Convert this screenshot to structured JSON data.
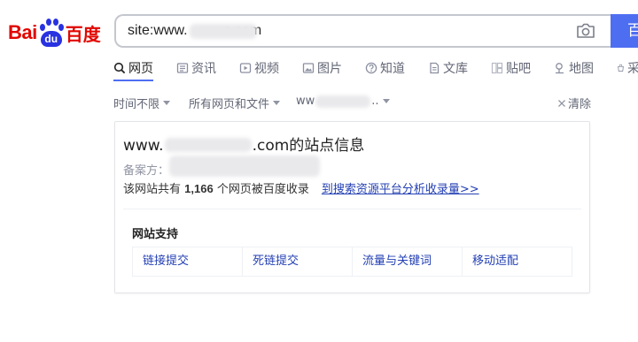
{
  "logo": {
    "bai": "Bai",
    "du": "du",
    "cn": "百度"
  },
  "search": {
    "query": "site:www.         o.com",
    "button_label": "百"
  },
  "tabs": [
    {
      "label": "网页",
      "icon": "search-icon",
      "active": true
    },
    {
      "label": "资讯",
      "icon": "news-icon"
    },
    {
      "label": "视频",
      "icon": "video-icon"
    },
    {
      "label": "图片",
      "icon": "image-icon"
    },
    {
      "label": "知道",
      "icon": "question-icon"
    },
    {
      "label": "文库",
      "icon": "document-icon"
    },
    {
      "label": "贴吧",
      "icon": "tieba-icon"
    },
    {
      "label": "地图",
      "icon": "map-icon"
    },
    {
      "label": "采",
      "icon": "shopping-icon"
    }
  ],
  "filters": {
    "time": "时间不限",
    "filetype": "所有网页和文件",
    "site": "ww",
    "site_suffix": "..",
    "clear": "清除"
  },
  "card": {
    "title_prefix": "www.",
    "title_suffix": ".com的站点信息",
    "beian_label": "备案方：",
    "stats_prefix": "该网站共有 ",
    "stats_count": "1,166",
    "stats_suffix": " 个网页被百度收录",
    "stats_link": "到搜索资源平台分析收录量>>",
    "support_title": "网站支持",
    "support_links": [
      "链接提交",
      "死链提交",
      "流量与关键词",
      "移动适配"
    ]
  },
  "colors": {
    "brand_red": "#e10601",
    "brand_blue": "#2932e1",
    "accent": "#4e6ef2",
    "link": "#2440b3"
  }
}
